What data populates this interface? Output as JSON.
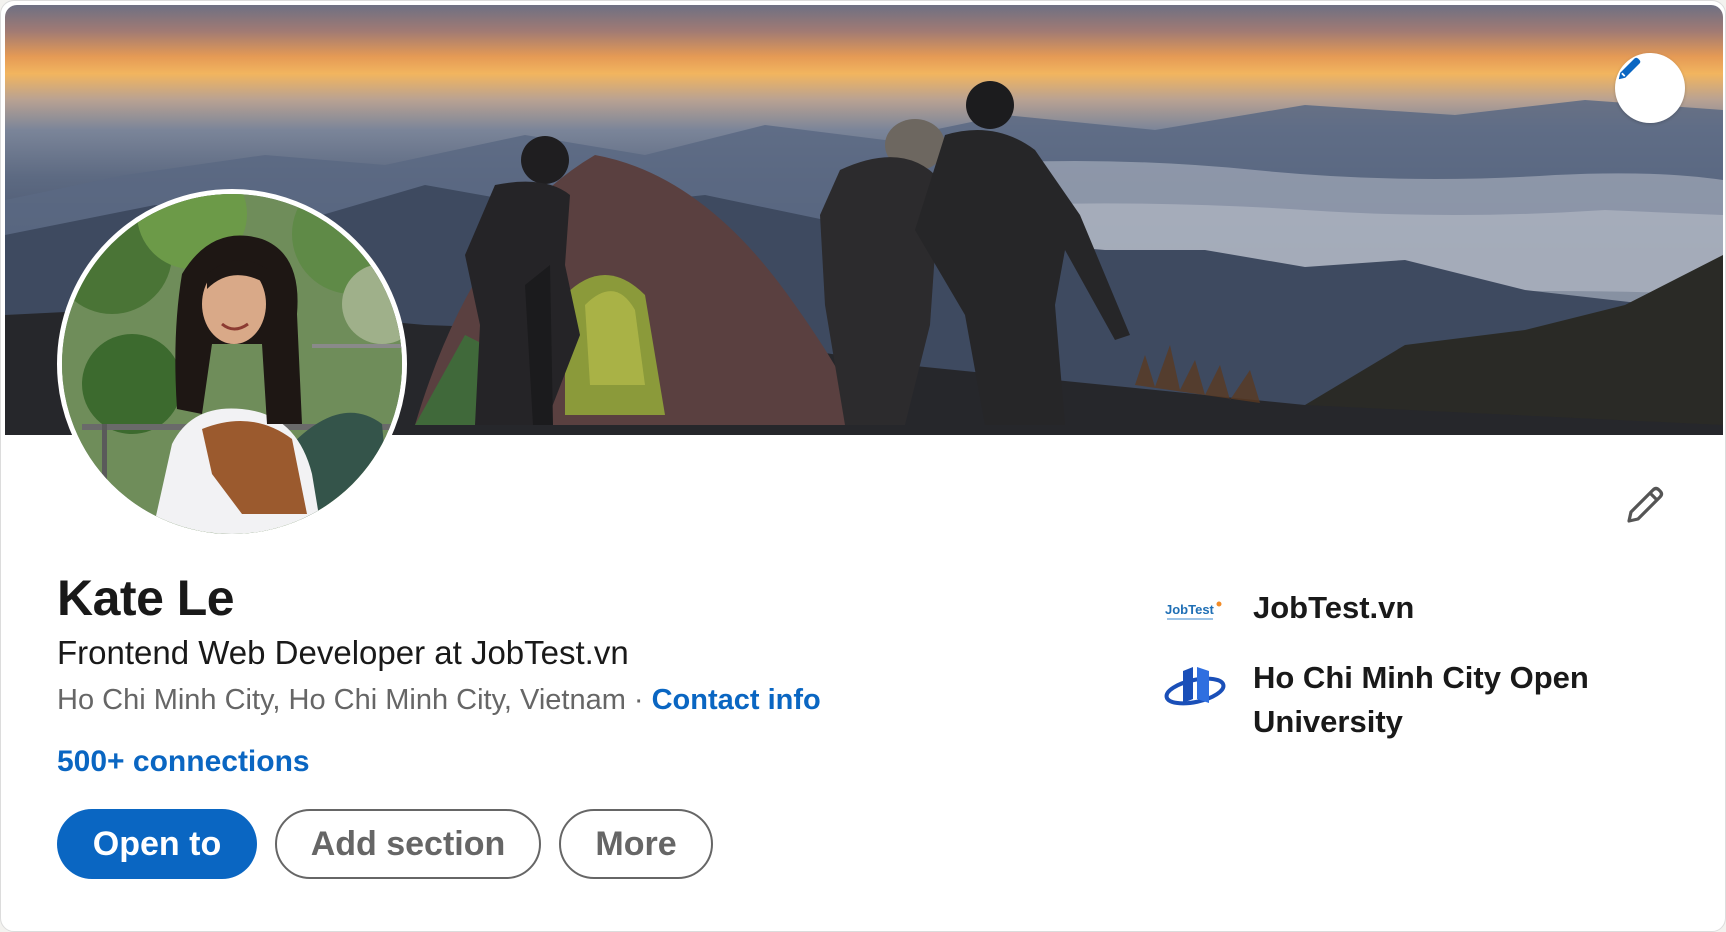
{
  "profile": {
    "name": "Kate Le",
    "headline": "Frontend Web Developer at JobTest.vn",
    "location": "Ho Chi Minh City, Ho Chi Minh City, Vietnam",
    "separator": "·",
    "contact_info_label": "Contact info",
    "connections_label": "500+ connections"
  },
  "actions": {
    "open_to_label": "Open to",
    "add_section_label": "Add section",
    "more_label": "More"
  },
  "highlights": {
    "company": {
      "name": "JobTest.vn",
      "logo_text": "JobTest"
    },
    "school": {
      "name": "Ho Chi Minh City Open University"
    }
  },
  "icons": {
    "edit_cover": "pencil-icon",
    "edit_intro": "pencil-outline-icon"
  },
  "colors": {
    "accent": "#0a66c2",
    "text_primary": "#191919",
    "text_secondary": "#666666"
  }
}
